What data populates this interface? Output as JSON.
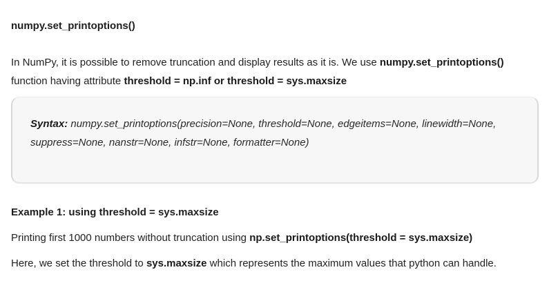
{
  "heading": "numpy.set_printoptions()",
  "intro": {
    "text1": "In NumPy, it is possible to remove truncation and display results as it is. We use ",
    "bold1": "numpy.set_printoptions()",
    "text2": " function having attribute ",
    "bold2": "threshold = np.inf or threshold = sys.maxsize"
  },
  "syntax": {
    "label": "Syntax:",
    "code": " numpy.set_printoptions(precision=None, threshold=None, edgeitems=None, linewidth=None, suppress=None, nanstr=None, infstr=None, formatter=None)"
  },
  "example": {
    "title": "Example 1: using threshold = sys.maxsize"
  },
  "para1": {
    "text1": "Printing first 1000 numbers without truncation using ",
    "bold1": "np.set_printoptions(threshold = sys.maxsize)"
  },
  "para2": {
    "text1": "Here, we set the threshold to ",
    "bold1": "sys.maxsize",
    "text2": " which represents the maximum values that python can handle."
  }
}
